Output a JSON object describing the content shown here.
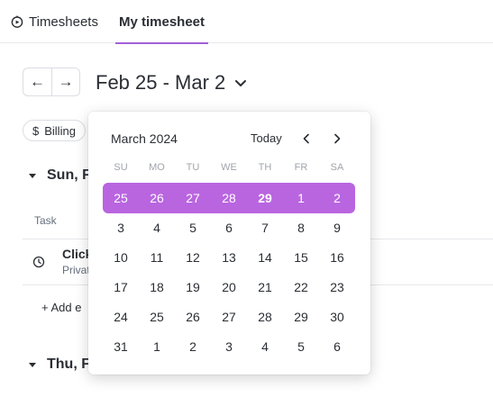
{
  "tabs": {
    "timesheets": "Timesheets",
    "my_timesheet": "My timesheet"
  },
  "nav": {
    "prev": "←",
    "next": "→",
    "range": "Feb 25 - Mar 2"
  },
  "filter": {
    "billing": "Billing",
    "billing_icon": "$"
  },
  "days": {
    "sun": "Sun, F",
    "thu": "Thu, F"
  },
  "table": {
    "task_header": "Task",
    "entry_name": "Click",
    "entry_sub": "Privat",
    "add_entry": "+ Add e"
  },
  "calendar": {
    "month_label": "March 2024",
    "today_label": "Today",
    "accent": "#b965e0",
    "weekdays": [
      "SU",
      "MO",
      "TU",
      "WE",
      "TH",
      "FR",
      "SA"
    ],
    "weeks": [
      [
        "25",
        "26",
        "27",
        "28",
        "29",
        "1",
        "2"
      ],
      [
        "3",
        "4",
        "5",
        "6",
        "7",
        "8",
        "9"
      ],
      [
        "10",
        "11",
        "12",
        "13",
        "14",
        "15",
        "16"
      ],
      [
        "17",
        "18",
        "19",
        "20",
        "21",
        "22",
        "23"
      ],
      [
        "24",
        "25",
        "26",
        "27",
        "28",
        "29",
        "30"
      ],
      [
        "31",
        "1",
        "2",
        "3",
        "4",
        "5",
        "6"
      ]
    ],
    "selected_week": 0,
    "today_cell": [
      0,
      4
    ]
  }
}
